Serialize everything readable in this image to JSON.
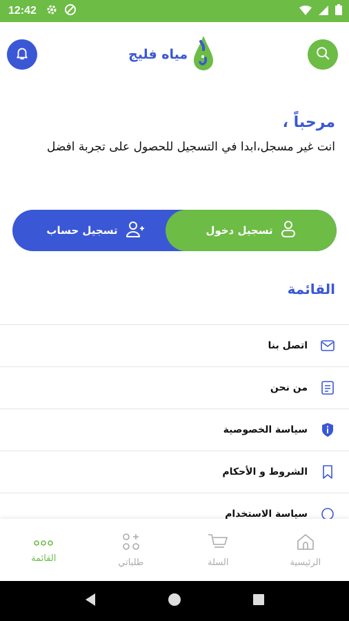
{
  "status_bar": {
    "time": "12:42"
  },
  "header": {
    "logo_text": "مياه فليج"
  },
  "welcome": {
    "title": "مرحباً ،",
    "message": "انت غير مسجل،ابدا في التسجيل للحصول على تجربة افضل"
  },
  "auth": {
    "login_label": "تسجيل دخول",
    "register_label": "تسجيل حساب"
  },
  "menu": {
    "title": "القائمة",
    "items": [
      {
        "label": "اتصل بنا",
        "icon": "mail-icon"
      },
      {
        "label": "من نحن",
        "icon": "document-icon"
      },
      {
        "label": "سياسة الخصوصية",
        "icon": "shield-info-icon"
      },
      {
        "label": "الشروط و الأحكام",
        "icon": "bookmark-icon"
      },
      {
        "label": "سياسة الاستخدام",
        "icon": "circle-icon"
      }
    ]
  },
  "bottom_nav": {
    "items": [
      {
        "label": "القائمة",
        "icon": "dots-icon",
        "active": true
      },
      {
        "label": "طلباتي",
        "icon": "grid-plus-icon",
        "active": false
      },
      {
        "label": "السلة",
        "icon": "cart-icon",
        "active": false
      },
      {
        "label": "الرئيسية",
        "icon": "home-icon",
        "active": false
      }
    ]
  },
  "colors": {
    "primary_green": "#6cbc45",
    "primary_blue": "#3a57d6"
  }
}
